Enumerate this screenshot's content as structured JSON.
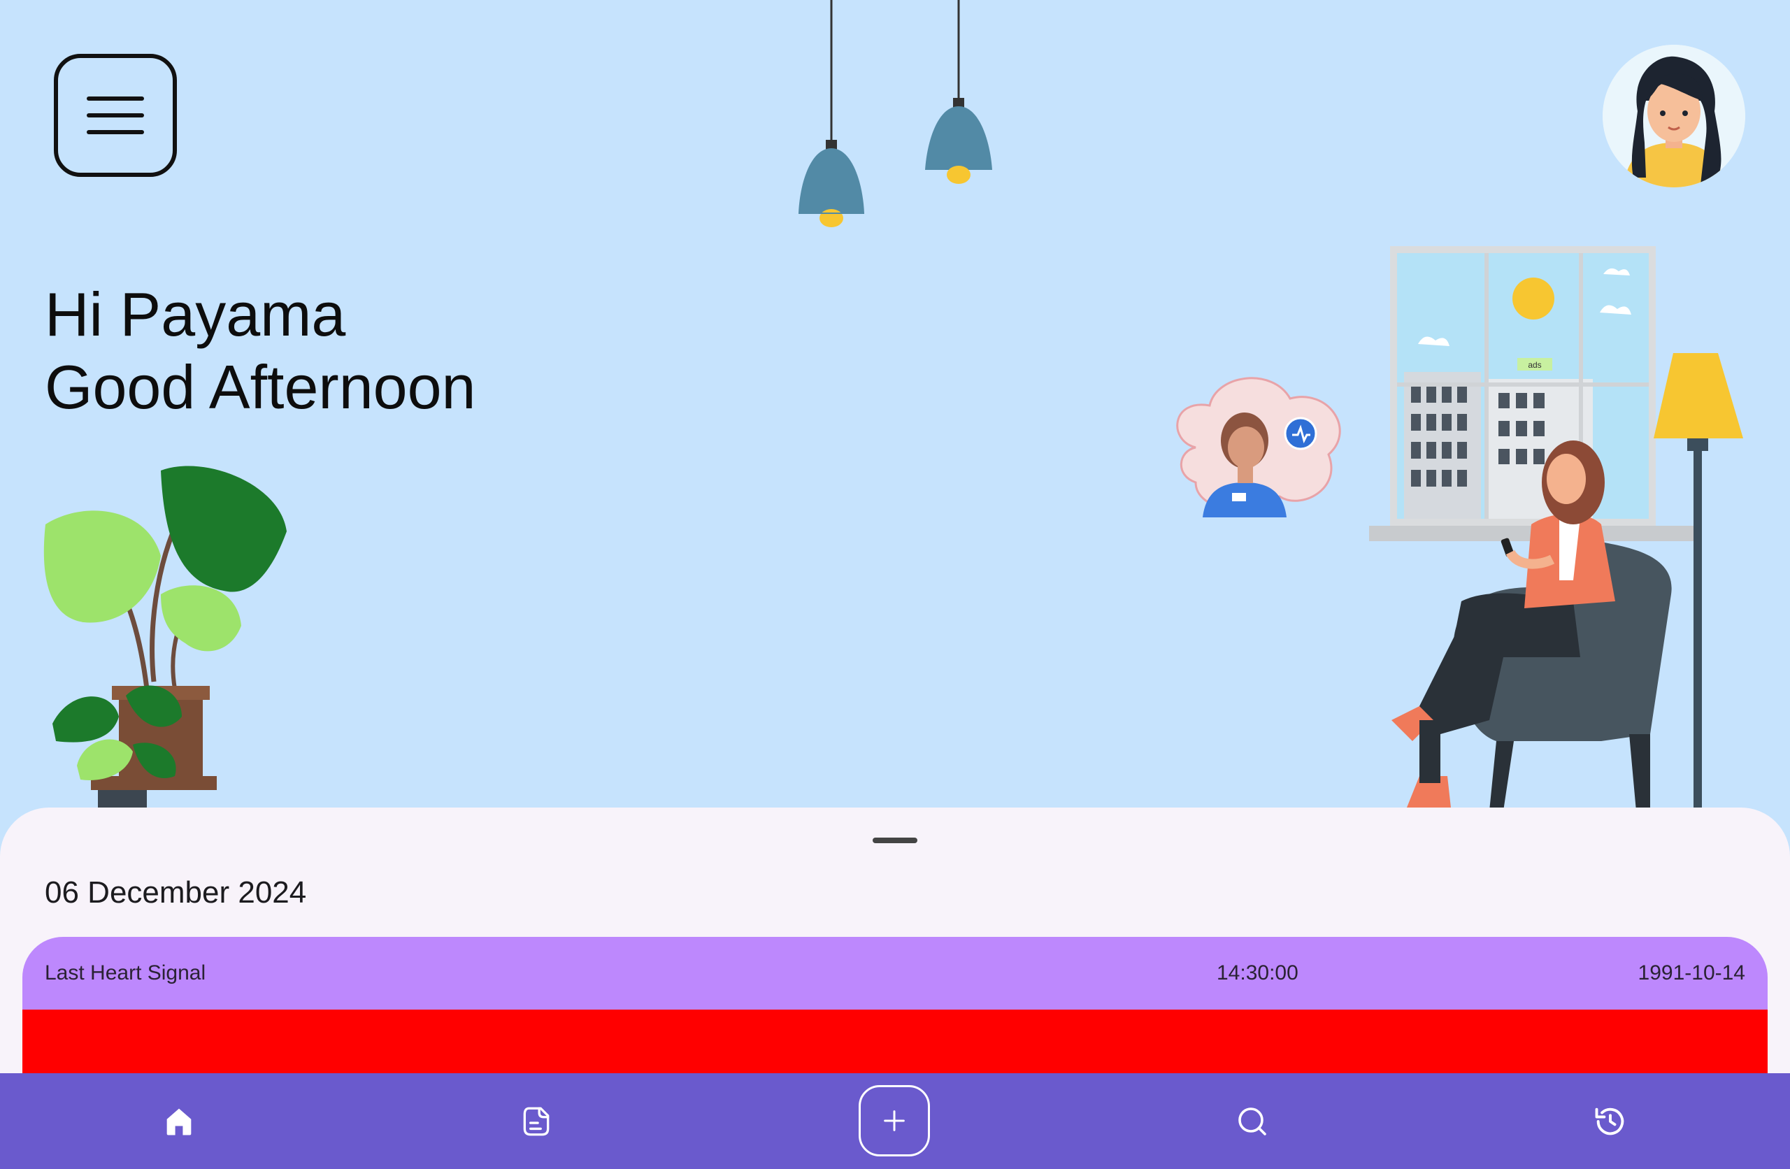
{
  "greeting": {
    "line1": "Hi Payama",
    "line2": "Good Afternoon"
  },
  "icons": {
    "menu": "menu-icon",
    "avatar": "user-avatar"
  },
  "sheet": {
    "date": "06 December 2024",
    "card": {
      "label": "Last Heart Signal",
      "time": "14:30:00",
      "date": "1991-10-14",
      "header_color": "#bd88fd",
      "signal_color": "#ff0000"
    }
  },
  "illustration": {
    "building_sign": "ads"
  },
  "nav": {
    "items": [
      {
        "icon": "home-icon",
        "active": true
      },
      {
        "icon": "document-icon"
      },
      {
        "icon": "add-icon"
      },
      {
        "icon": "search-icon"
      },
      {
        "icon": "history-icon"
      }
    ],
    "background": "#6a5acd"
  }
}
